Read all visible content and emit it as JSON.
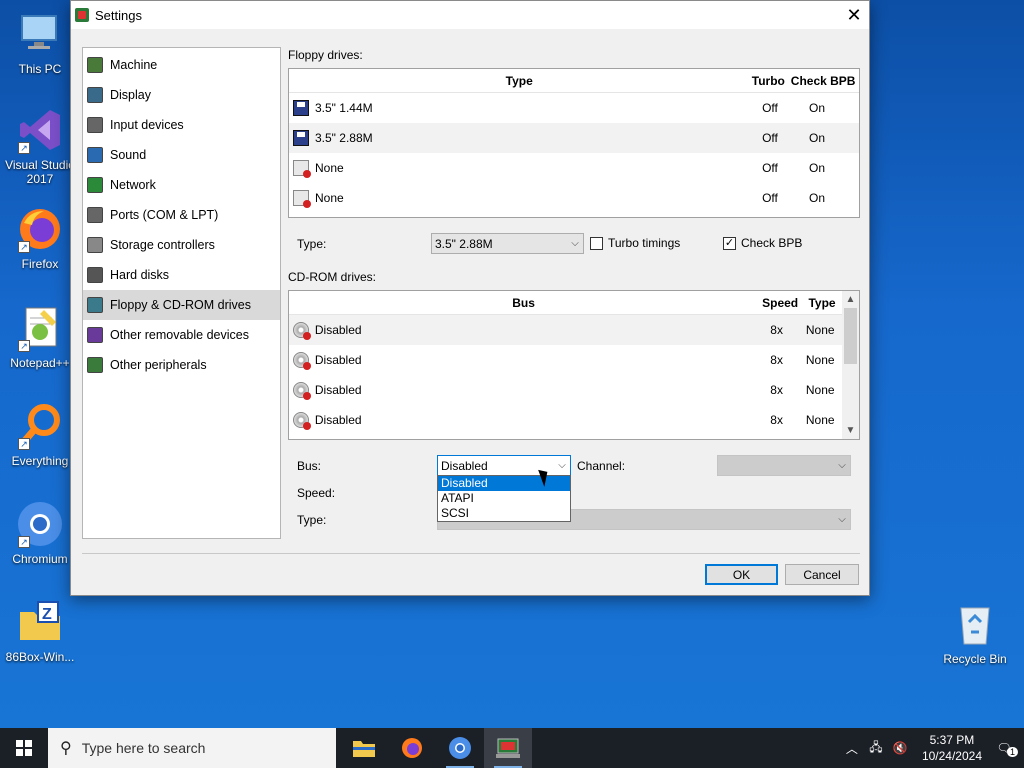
{
  "desktop_icons": [
    {
      "name": "this-pc",
      "label": "This PC"
    },
    {
      "name": "visual-studio",
      "label": "Visual Studio 2017"
    },
    {
      "name": "firefox",
      "label": "Firefox"
    },
    {
      "name": "notepadpp",
      "label": "Notepad++"
    },
    {
      "name": "everything",
      "label": "Everything"
    },
    {
      "name": "chromium",
      "label": "Chromium"
    },
    {
      "name": "86box",
      "label": "86Box-Win..."
    },
    {
      "name": "recycle-bin",
      "label": "Recycle Bin"
    }
  ],
  "dialog": {
    "title": "Settings",
    "close_glyph": "✕",
    "nav": [
      {
        "label": "Machine",
        "color": "#4a7a3a"
      },
      {
        "label": "Display",
        "color": "#3a6a8a"
      },
      {
        "label": "Input devices",
        "color": "#666"
      },
      {
        "label": "Sound",
        "color": "#2a6ab0"
      },
      {
        "label": "Network",
        "color": "#2a8a3a"
      },
      {
        "label": "Ports (COM & LPT)",
        "color": "#666"
      },
      {
        "label": "Storage controllers",
        "color": "#888"
      },
      {
        "label": "Hard disks",
        "color": "#555"
      },
      {
        "label": "Floppy & CD-ROM drives",
        "color": "#3a7a8a"
      },
      {
        "label": "Other removable devices",
        "color": "#6a3a9a"
      },
      {
        "label": "Other peripherals",
        "color": "#3a7a3a"
      }
    ],
    "floppy": {
      "section_label": "Floppy drives:",
      "headers": {
        "type": "Type",
        "turbo": "Turbo",
        "check_bpb": "Check BPB"
      },
      "rows": [
        {
          "type": "3.5\" 1.44M",
          "turbo": "Off",
          "check_bpb": "On",
          "icon": "floppy"
        },
        {
          "type": "3.5\" 2.88M",
          "turbo": "Off",
          "check_bpb": "On",
          "icon": "floppy"
        },
        {
          "type": "None",
          "turbo": "Off",
          "check_bpb": "On",
          "icon": "none"
        },
        {
          "type": "None",
          "turbo": "Off",
          "check_bpb": "On",
          "icon": "none"
        }
      ],
      "type_label": "Type:",
      "type_value": "3.5\" 2.88M",
      "turbo_label": "Turbo timings",
      "turbo_checked": false,
      "check_bpb_label": "Check BPB",
      "check_bpb_checked": true
    },
    "cdrom": {
      "section_label": "CD-ROM drives:",
      "headers": {
        "bus": "Bus",
        "speed": "Speed",
        "type": "Type"
      },
      "rows": [
        {
          "bus": "Disabled",
          "speed": "8x",
          "type": "None"
        },
        {
          "bus": "Disabled",
          "speed": "8x",
          "type": "None"
        },
        {
          "bus": "Disabled",
          "speed": "8x",
          "type": "None"
        },
        {
          "bus": "Disabled",
          "speed": "8x",
          "type": "None"
        }
      ],
      "bus_label": "Bus:",
      "bus_value": "Disabled",
      "channel_label": "Channel:",
      "speed_label": "Speed:",
      "type_label": "Type:",
      "bus_options": [
        "Disabled",
        "ATAPI",
        "SCSI"
      ],
      "bus_selected": "Disabled"
    },
    "ok_label": "OK",
    "cancel_label": "Cancel"
  },
  "taskbar": {
    "search_placeholder": "Type here to search",
    "time": "5:37 PM",
    "date": "10/24/2024",
    "notification_count": "1"
  },
  "colors": {
    "accent": "#0078d7",
    "desktop": "#1668cc",
    "taskbar": "#1b1f26"
  }
}
